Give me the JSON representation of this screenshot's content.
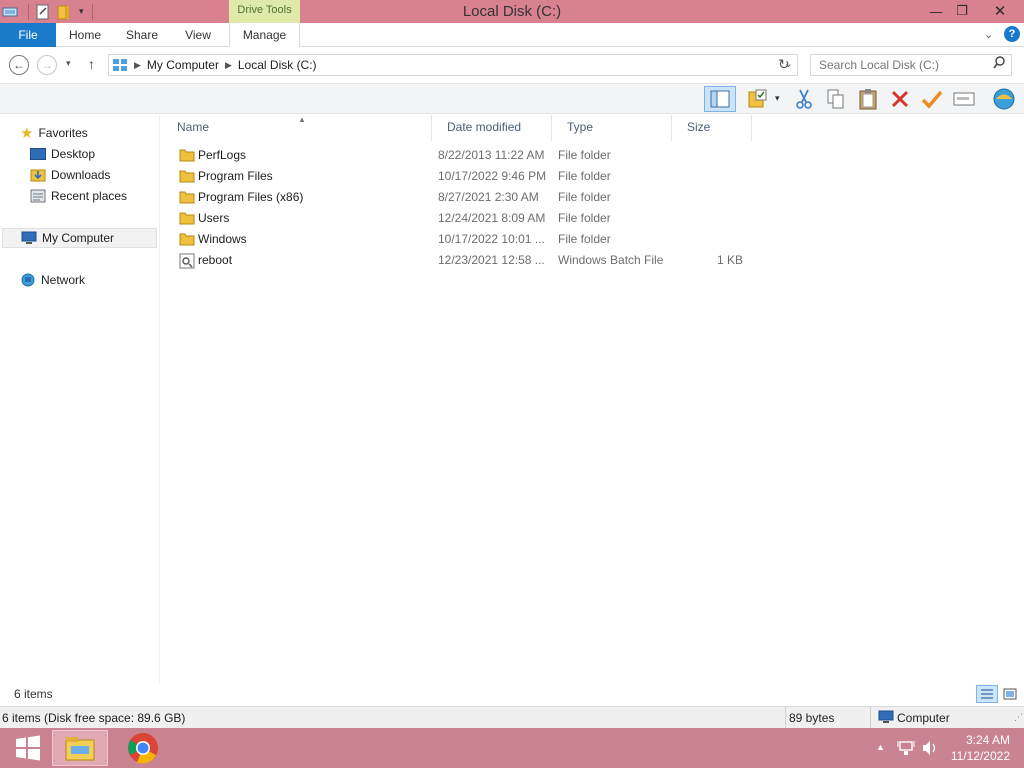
{
  "window": {
    "title": "Local Disk (C:)",
    "context_tab": "Drive Tools"
  },
  "ribbon": {
    "tabs": [
      "File",
      "Home",
      "Share",
      "View",
      "Manage"
    ]
  },
  "address": {
    "segments": [
      "My Computer",
      "Local Disk (C:)"
    ],
    "search_placeholder": "Search Local Disk (C:)"
  },
  "nav": {
    "favorites": "Favorites",
    "desktop": "Desktop",
    "downloads": "Downloads",
    "recent": "Recent places",
    "computer": "My Computer",
    "network": "Network"
  },
  "columns": [
    "Name",
    "Date modified",
    "Type",
    "Size"
  ],
  "files": [
    {
      "name": "PerfLogs",
      "date": "8/22/2013 11:22 AM",
      "type": "File folder",
      "size": "",
      "icon": "folder-icon"
    },
    {
      "name": "Program Files",
      "date": "10/17/2022 9:46 PM",
      "type": "File folder",
      "size": "",
      "icon": "folder-icon"
    },
    {
      "name": "Program Files (x86)",
      "date": "8/27/2021 2:30 AM",
      "type": "File folder",
      "size": "",
      "icon": "folder-icon"
    },
    {
      "name": "Users",
      "date": "12/24/2021 8:09 AM",
      "type": "File folder",
      "size": "",
      "icon": "folder-icon"
    },
    {
      "name": "Windows",
      "date": "10/17/2022 10:01 ...",
      "type": "File folder",
      "size": "",
      "icon": "folder-icon"
    },
    {
      "name": "reboot",
      "date": "12/23/2021 12:58 ...",
      "type": "Windows Batch File",
      "size": "1 KB",
      "icon": "batch-file-icon"
    }
  ],
  "status": {
    "items": "6 items",
    "details": "6 items (Disk free space: 89.6 GB)",
    "bytes": "89 bytes",
    "location": "Computer"
  },
  "taskbar": {
    "time": "3:24 AM",
    "date": "11/12/2022"
  },
  "colors": {
    "titlebar": "#d8818f",
    "taskbar": "#c98391",
    "file_tab": "#1979ca",
    "context_tab": "#dfe9a8"
  }
}
